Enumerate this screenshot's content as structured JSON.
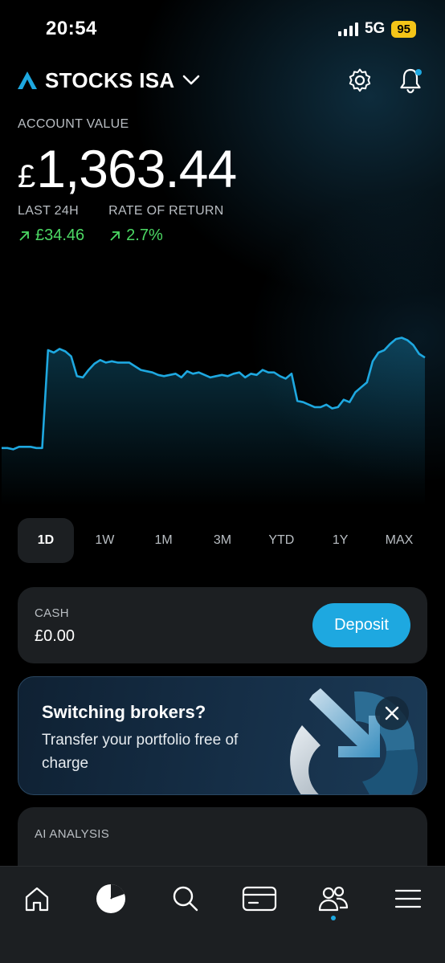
{
  "status_bar": {
    "time": "20:54",
    "network": "5G",
    "battery": "95"
  },
  "header": {
    "account_name": "STOCKS ISA"
  },
  "account": {
    "label": "ACCOUNT VALUE",
    "currency_symbol": "£",
    "value": "1,363.44",
    "last24_label": "LAST 24H",
    "last24_value": "£34.46",
    "return_label": "RATE OF RETURN",
    "return_value": "2.7%"
  },
  "chart_data": {
    "type": "area",
    "values": [
      39,
      39,
      38,
      40,
      40,
      40,
      39,
      39,
      118,
      116,
      119,
      117,
      113,
      97,
      96,
      102,
      107,
      110,
      108,
      109,
      108,
      108,
      108,
      105,
      102,
      101,
      100,
      98,
      97,
      98,
      99,
      96,
      101,
      99,
      100,
      98,
      96,
      97,
      98,
      97,
      99,
      100,
      96,
      99,
      98,
      102,
      100,
      100,
      97,
      95,
      99,
      77,
      76,
      74,
      72,
      72,
      74,
      71,
      72,
      78,
      76,
      84,
      88,
      92,
      109,
      116,
      118,
      123,
      127,
      128,
      126,
      122,
      115,
      112
    ],
    "color": "#1ea8e0"
  },
  "ranges": [
    "1D",
    "1W",
    "1M",
    "3M",
    "YTD",
    "1Y",
    "MAX"
  ],
  "active_range": "1D",
  "cash": {
    "label": "CASH",
    "value": "£0.00",
    "button": "Deposit"
  },
  "promo": {
    "title": "Switching brokers?",
    "text": "Transfer your portfolio free of charge"
  },
  "ai": {
    "label": "AI ANALYSIS"
  },
  "colors": {
    "accent": "#1ea8e0",
    "positive": "#4cd964",
    "card": "#1c1f22",
    "battery": "#f5c518"
  }
}
